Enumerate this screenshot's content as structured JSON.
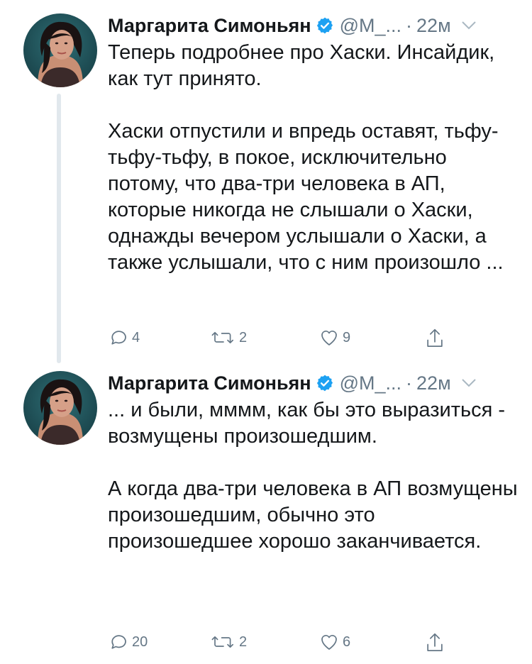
{
  "tweets": [
    {
      "author_name": "Маргарита Симоньян",
      "handle": "@M_...",
      "separator": "·",
      "time": "22м",
      "paragraphs": [
        "Теперь подробнее про Хаски. Инсайдик, как тут принято.",
        "Хаски отпустили и впредь оставят, тьфу-тьфу-тьфу, в покое, исключительно потому, что два-три человека в АП, которые никогда не слышали о Хаски, однажды вечером услышали о Хаски, а также услышали, что с ним произошло ..."
      ],
      "replies": "4",
      "retweets": "2",
      "likes": "9"
    },
    {
      "author_name": "Маргарита Симоньян",
      "handle": "@M_...",
      "separator": "·",
      "time": "22м",
      "paragraphs": [
        "... и были, мммм, как бы это выразиться - возмущены произошедшим.",
        "А когда два-три человека в АП возмущены произошедшим, обычно это произошедшее хорошо заканчивается."
      ],
      "replies": "20",
      "retweets": "2",
      "likes": "6"
    }
  ],
  "icons": {
    "verified": "verified-badge-icon",
    "more": "chevron-down-icon",
    "reply": "reply-icon",
    "retweet": "retweet-icon",
    "like": "heart-icon",
    "share": "share-icon"
  },
  "colors": {
    "text": "#14171a",
    "secondary": "#657786",
    "verified": "#1da1f2",
    "thread_line": "#e1e8ed"
  }
}
